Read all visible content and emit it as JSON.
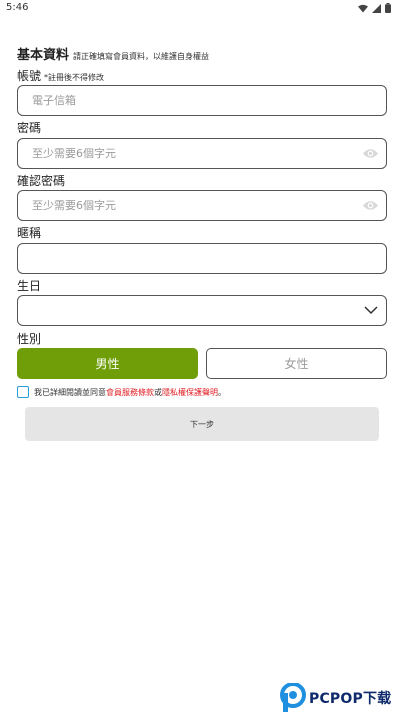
{
  "status_bar": {
    "time": "5:46"
  },
  "form": {
    "title": "基本資料",
    "subtitle": "請正確填寫會員資料，以維護自身權益",
    "account": {
      "label": "帳號",
      "note": "*註冊後不得修改",
      "placeholder": "電子信箱"
    },
    "password": {
      "label": "密碼",
      "placeholder": "至少需要6個字元"
    },
    "confirm_password": {
      "label": "確認密碼",
      "placeholder": "至少需要6個字元"
    },
    "nickname": {
      "label": "暱稱",
      "placeholder": ""
    },
    "birthday": {
      "label": "生日",
      "value": ""
    },
    "gender": {
      "label": "性別",
      "male": "男性",
      "female": "女性",
      "selected": "男性"
    },
    "agree": {
      "prefix": "我已詳細閱讀並同意",
      "terms": "會員服務條款",
      "or": "或",
      "privacy": "隱私權保護聲明",
      "suffix": "。"
    },
    "next_label": "下一步"
  },
  "watermark": {
    "text": "PCPOP下载"
  },
  "colors": {
    "accent_green": "#6f9e09",
    "link_red": "#e0181f",
    "checkbox_blue": "#2a9fd6",
    "button_grey": "#e5e5e5"
  }
}
